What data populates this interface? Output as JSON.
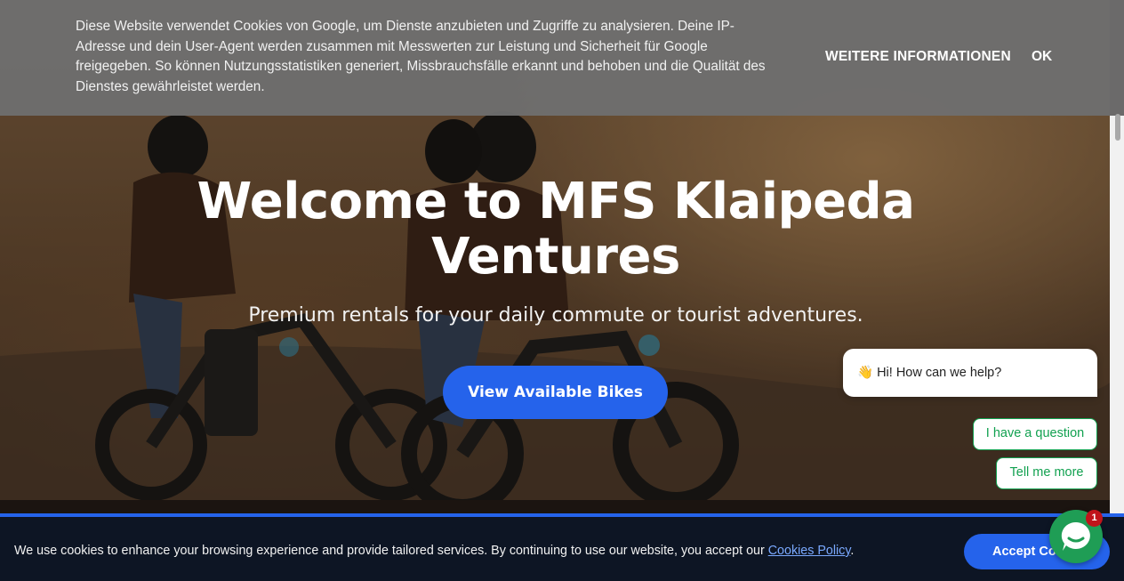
{
  "hero": {
    "title": "Welcome to MFS Klaipeda Ventures",
    "subtitle": "Premium rentals for your daily commute or tourist adventures.",
    "cta_label": "View Available Bikes"
  },
  "top_cookie_banner": {
    "text": "Diese Website verwendet Cookies von Google, um Dienste anzubieten und Zugriffe zu analysieren. Deine IP-Adresse und dein User-Agent werden zusammen mit Messwerten zur Leistung und Sicherheit für Google freigegeben. So können Nutzungsstatistiken generiert, Missbrauchsfälle erkannt und behoben und die Qualität des Dienstes gewährleistet werden.",
    "more_info_label": "WEITERE INFORMATIONEN",
    "ok_label": "OK"
  },
  "chat_widget": {
    "greeting_emoji": "👋",
    "greeting": "Hi! How can we help?",
    "options": [
      "I have a question",
      "Tell me more"
    ],
    "badge_count": "1",
    "launcher_icon": "chat-bubble-icon"
  },
  "bottom_cookie_bar": {
    "text_before": "We use cookies to enhance your browsing experience and provide tailored services. By continuing to use our website, you accept our ",
    "link_label": "Cookies Policy",
    "text_after": ".",
    "accept_label": "Accept Cookies"
  },
  "colors": {
    "accent": "#2563eb",
    "chat_green": "#1f9d55",
    "bottom_bar_bg": "#0d1524",
    "top_banner_bg": "#6e6e6e"
  }
}
